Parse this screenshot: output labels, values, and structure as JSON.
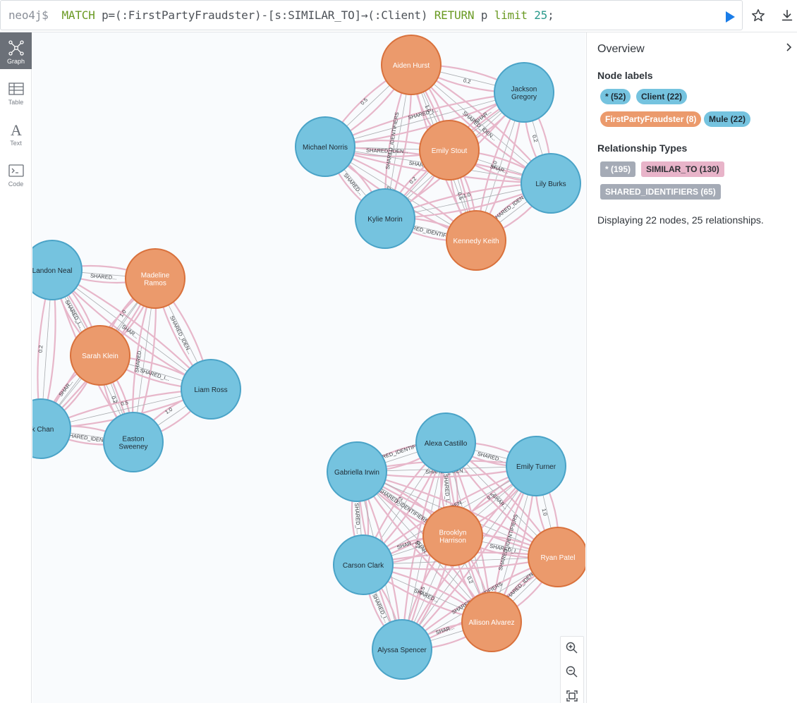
{
  "query": {
    "prompt": "neo4j$",
    "tokens": [
      {
        "t": "MATCH",
        "c": "kw"
      },
      {
        "t": " p=(:FirstPartyFraudster)-[s:SIMILAR_TO]→(:Client) ",
        "c": "txt"
      },
      {
        "t": "RETURN",
        "c": "kw"
      },
      {
        "t": " p ",
        "c": "txt"
      },
      {
        "t": "limit",
        "c": "kw"
      },
      {
        "t": " ",
        "c": "txt"
      },
      {
        "t": "25",
        "c": "num"
      },
      {
        "t": ";",
        "c": "txt"
      }
    ]
  },
  "toolbar": {
    "run_icon": "play-icon",
    "favorite_icon": "star-icon",
    "download_icon": "download-icon"
  },
  "rail": [
    {
      "label": "Graph",
      "icon": "graph-icon",
      "active": true
    },
    {
      "label": "Table",
      "icon": "table-icon",
      "active": false
    },
    {
      "label": "Text",
      "icon": "text-icon",
      "active": false
    },
    {
      "label": "Code",
      "icon": "code-icon",
      "active": false
    }
  ],
  "colors": {
    "client": "#75c3df",
    "client_stroke": "#4aa3c7",
    "fraudster": "#eb9a6c",
    "fraudster_stroke": "#d9713c",
    "edge": "#e7b7ca",
    "edge_dark": "#a9acb0",
    "rel_all": "#a5abb6",
    "rel_similar": "#e8b4c9",
    "rel_shared": "#a5abb6"
  },
  "overview": {
    "title": "Overview",
    "node_labels_title": "Node labels",
    "node_labels": [
      {
        "text": "* (52)",
        "kind": "client"
      },
      {
        "text": "Client (22)",
        "kind": "client"
      },
      {
        "text": "FirstPartyFraudster (8)",
        "kind": "fraudster"
      },
      {
        "text": "Mule (22)",
        "kind": "client"
      }
    ],
    "rel_types_title": "Relationship Types",
    "rel_types": [
      {
        "text": "* (195)",
        "kind": "all"
      },
      {
        "text": "SIMILAR_TO (130)",
        "kind": "similar"
      },
      {
        "text": "SHARED_IDENTIFIERS (65)",
        "kind": "shared"
      }
    ],
    "summary": "Displaying 22 nodes, 25 relationships."
  },
  "graph": {
    "clusters": [
      {
        "nodes": [
          {
            "id": "aiden",
            "lines": [
              "Aiden Hurst"
            ],
            "type": "fraudster"
          },
          {
            "id": "jackson",
            "lines": [
              "Jackson",
              "Gregory"
            ],
            "type": "client"
          },
          {
            "id": "michael",
            "lines": [
              "Michael Norris"
            ],
            "type": "client"
          },
          {
            "id": "emily_s",
            "lines": [
              "Emily Stout"
            ],
            "type": "fraudster"
          },
          {
            "id": "lily",
            "lines": [
              "Lily Burks"
            ],
            "type": "client"
          },
          {
            "id": "kylie",
            "lines": [
              "Kylie Morin"
            ],
            "type": "client"
          },
          {
            "id": "kennedy",
            "lines": [
              "Kennedy Keith"
            ],
            "type": "fraudster"
          }
        ]
      },
      {
        "nodes": [
          {
            "id": "landon",
            "lines": [
              "Landon Neal"
            ],
            "type": "client"
          },
          {
            "id": "madeline",
            "lines": [
              "Madeline",
              "Ramos"
            ],
            "type": "fraudster"
          },
          {
            "id": "sarah",
            "lines": [
              "Sarah Klein"
            ],
            "type": "fraudster"
          },
          {
            "id": "liam",
            "lines": [
              "Liam Ross"
            ],
            "type": "client"
          },
          {
            "id": "chan",
            "lines": [
              "ck Chan"
            ],
            "type": "client"
          },
          {
            "id": "easton",
            "lines": [
              "Easton",
              "Sweeney"
            ],
            "type": "client"
          }
        ]
      },
      {
        "nodes": [
          {
            "id": "alexa",
            "lines": [
              "Alexa Castillo"
            ],
            "type": "client"
          },
          {
            "id": "gabriella",
            "lines": [
              "Gabriella Irwin"
            ],
            "type": "client"
          },
          {
            "id": "emily_t",
            "lines": [
              "Emily Turner"
            ],
            "type": "client"
          },
          {
            "id": "brooklyn",
            "lines": [
              "Brooklyn",
              "Harrison"
            ],
            "type": "fraudster"
          },
          {
            "id": "ryan",
            "lines": [
              "Ryan Patel"
            ],
            "type": "fraudster"
          },
          {
            "id": "carson",
            "lines": [
              "Carson Clark"
            ],
            "type": "client"
          },
          {
            "id": "allison",
            "lines": [
              "Allison Alvarez"
            ],
            "type": "fraudster"
          },
          {
            "id": "alyssa",
            "lines": [
              "Alyssa Spencer"
            ],
            "type": "client"
          }
        ]
      }
    ],
    "edge_label_texts": [
      "0.2",
      "0.5",
      "1.0",
      "SHARED_IDEN...",
      "SHARED_IDENTIFIERS",
      "SHARED...",
      "SHARED_I...",
      "SHAR..."
    ]
  },
  "zoom": {
    "in_icon": "zoom-in-icon",
    "out_icon": "zoom-out-icon",
    "fit_icon": "fit-icon"
  }
}
